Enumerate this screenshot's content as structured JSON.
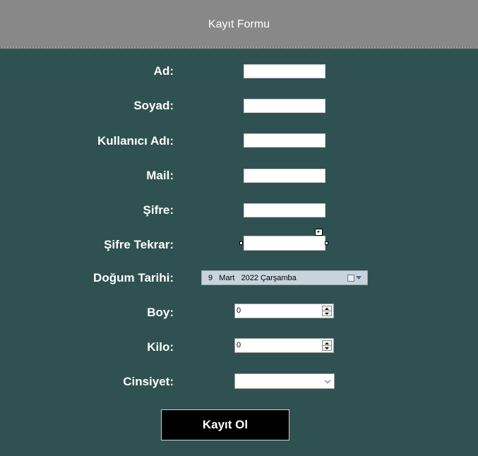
{
  "header": {
    "title": "Kayıt Formu"
  },
  "form": {
    "labels": {
      "ad": "Ad:",
      "soyad": "Soyad:",
      "kullanici_adi": "Kullanıcı Adı:",
      "mail": "Mail:",
      "sifre": "Şifre:",
      "sifre_tekrar": "Şifre Tekrar:",
      "dogum_tarihi": "Doğum Tarihi:",
      "boy": "Boy:",
      "kilo": "Kilo:",
      "cinsiyet": "Cinsiyet:"
    },
    "values": {
      "ad": "",
      "soyad": "",
      "kullanici_adi": "",
      "mail": "",
      "sifre": "",
      "sifre_tekrar": "",
      "dogum_tarihi": "9   Mart   2022 Çarşamba",
      "boy": "0",
      "kilo": "0",
      "cinsiyet": ""
    },
    "smart_tag_glyph": "▸",
    "submit_label": "Kayıt Ol"
  },
  "colors": {
    "background": "#2f5151",
    "header": "#888888",
    "button": "#000000"
  }
}
